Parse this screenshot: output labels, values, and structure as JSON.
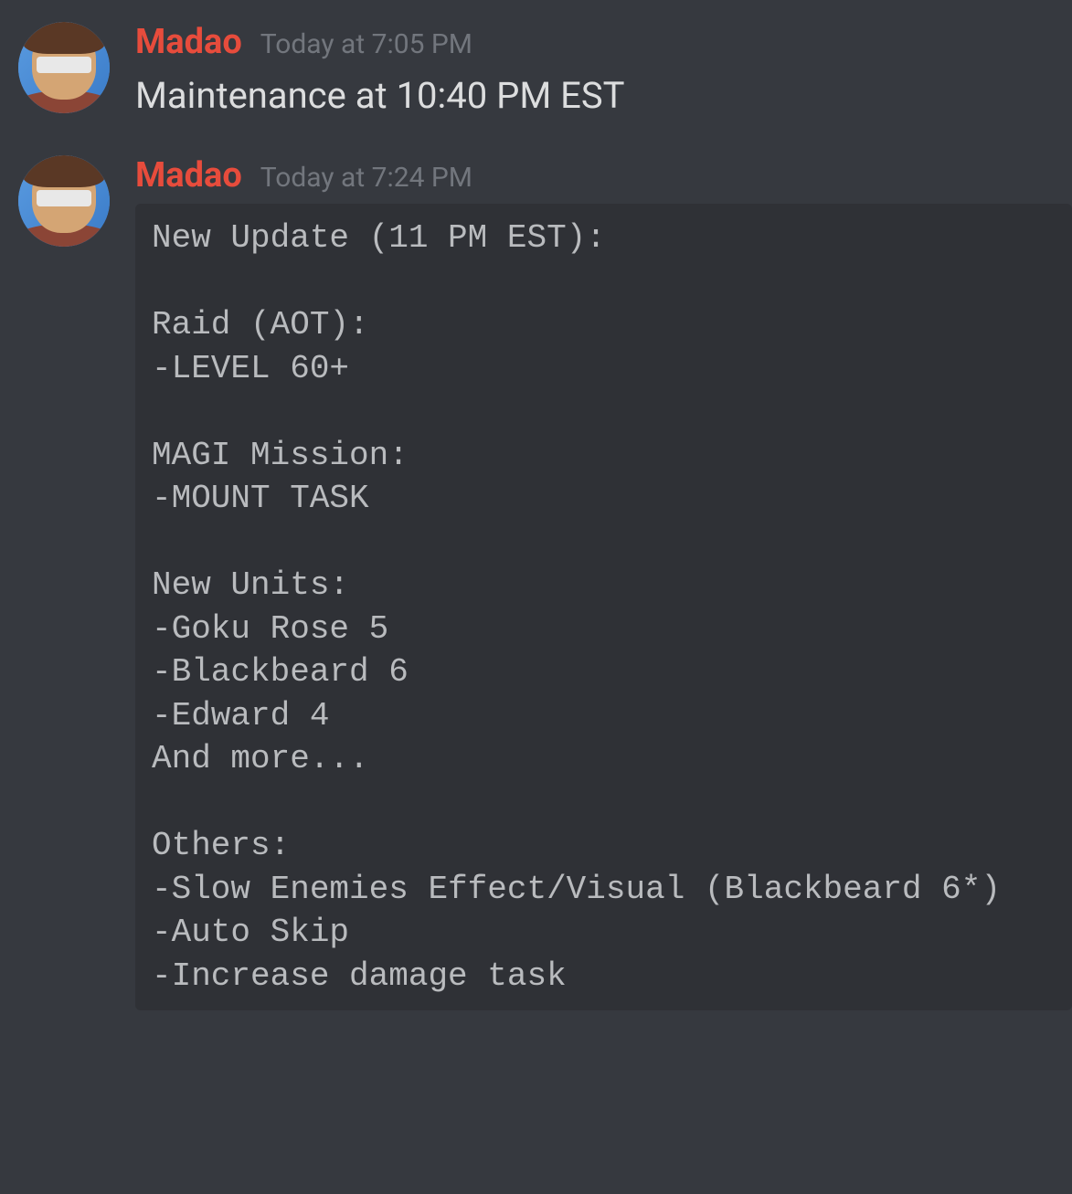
{
  "messages": [
    {
      "author": "Madao",
      "timestamp": "Today at 7:05 PM",
      "text": "Maintenance at 10:40 PM EST"
    },
    {
      "author": "Madao",
      "timestamp": "Today at 7:24 PM",
      "code": "New Update (11 PM EST):\n\nRaid (AOT):\n-LEVEL 60+\n\nMAGI Mission:\n-MOUNT TASK\n\nNew Units:\n-Goku Rose 5\n-Blackbeard 6\n-Edward 4\nAnd more...\n\nOthers:\n-Slow Enemies Effect/Visual (Blackbeard 6*)\n-Auto Skip\n-Increase damage task"
    }
  ]
}
